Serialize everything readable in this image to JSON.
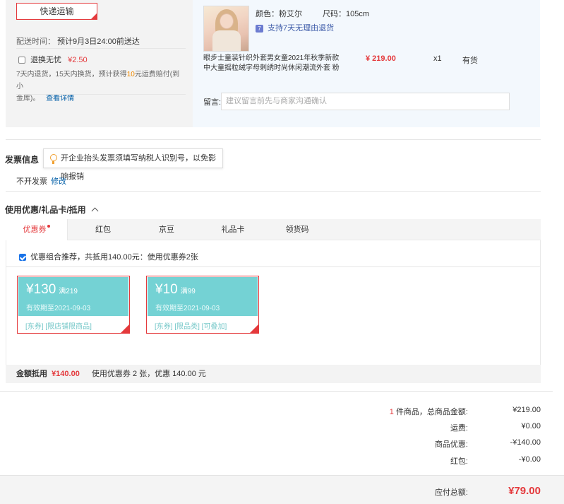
{
  "shipping": {
    "method_button": "快递运输",
    "delivery_label": "配送时间：",
    "delivery_value": "预计9月3日24:00前送达",
    "return_worry_label": "退换无忧",
    "return_worry_price": "¥2.50",
    "return_desc_1": "7天内退货，15天内换货，预计获得",
    "return_desc_highlight": "10",
    "return_desc_2": "元运费赔付(到小",
    "return_desc_3": "金库)。",
    "view_details": "查看详情"
  },
  "product": {
    "color_label": "颜色：粉艾尔",
    "size_label": "尺码：105cm",
    "return_policy": "支持7天无理由退货",
    "title_line1": "眼步士童装针织外套男女童2021年秋季新款",
    "title_line2": "中大童摇粒绒字母刺绣时尚休闲潮流外套 粉",
    "price": "¥ 219.00",
    "quantity": "x1",
    "stock": "有货",
    "remark_label": "留言:",
    "remark_placeholder": "建议留言前先与商家沟通确认"
  },
  "invoice": {
    "title": "发票信息",
    "tooltip": "开企业抬头发票须填写纳税人识别号，以免影响报销",
    "status": "不开发票",
    "edit_link": "修改"
  },
  "discounts": {
    "title": "使用优惠/礼品卡/抵用",
    "tabs": [
      {
        "label": "优惠券",
        "active": true
      },
      {
        "label": "红包",
        "active": false
      },
      {
        "label": "京豆",
        "active": false
      },
      {
        "label": "礼品卡",
        "active": false
      },
      {
        "label": "领货码",
        "active": false
      }
    ],
    "combo_text": "优惠组合推荐，共抵用140.00元：使用优惠券2张",
    "combo_checked": true,
    "coupons": [
      {
        "amount": "¥130",
        "condition": "满219",
        "expire": "有效期至2021-09-03",
        "tags": "[东券]  [限店铺限商品]",
        "selected": true
      },
      {
        "amount": "¥10",
        "condition": "满99",
        "expire": "有效期至2021-09-03",
        "tags": "[东券]  [限品类]  [可叠加]",
        "selected": true
      }
    ],
    "deduct_label": "金额抵用",
    "deduct_value": "¥140.00",
    "deduct_summary": "使用优惠券 2 张，优惠 140.00 元"
  },
  "summary": {
    "count_prefix": "1",
    "count_label": "件商品，总商品金额:",
    "total_goods": "¥219.00",
    "freight_label": "运费:",
    "freight": "¥0.00",
    "discount_label": "商品优惠:",
    "discount": "-¥140.00",
    "redpacket_label": "红包:",
    "redpacket": "-¥0.00",
    "payable_label": "应付总额:",
    "payable": "¥79.00"
  },
  "colors": {
    "accent": "#e4393c",
    "coupon_teal": "#74d2d4",
    "link": "#005ea7"
  }
}
